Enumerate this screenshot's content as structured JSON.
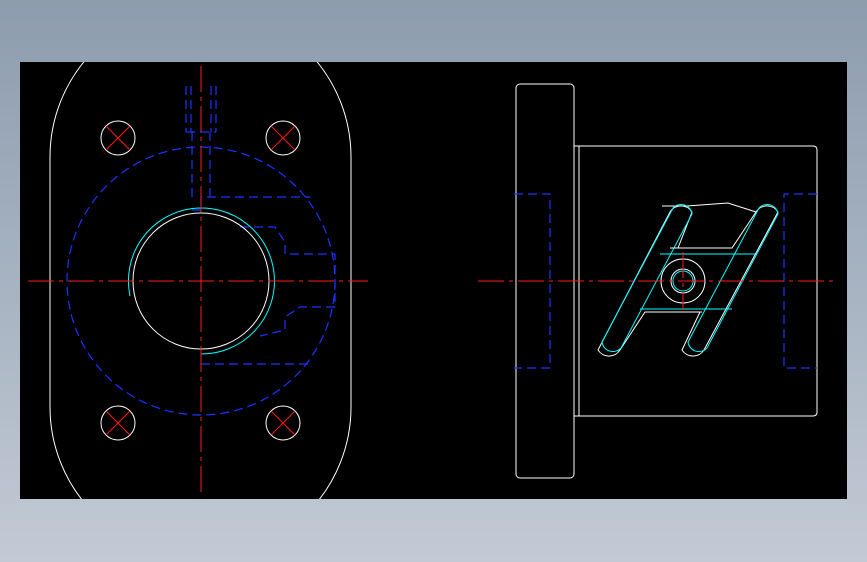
{
  "colors": {
    "background": "#000000",
    "outline": "#ffffff",
    "hidden_line": "#1a33ff",
    "center_line": "#ff1a1a",
    "bore_detail": "#00ffff"
  },
  "views": {
    "front": "front-view",
    "side": "side-view"
  }
}
